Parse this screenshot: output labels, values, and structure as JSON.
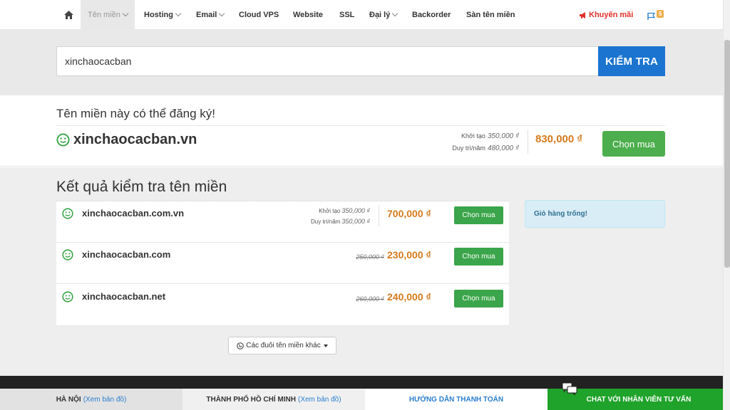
{
  "nav": {
    "items": [
      {
        "label": "Tên miền",
        "caret": true,
        "active": true
      },
      {
        "label": "Hosting",
        "caret": true
      },
      {
        "label": "Email",
        "caret": true
      },
      {
        "label": "Cloud VPS"
      },
      {
        "label": "Website"
      },
      {
        "label": "SSL"
      },
      {
        "label": "Đại lý",
        "caret": true
      },
      {
        "label": "Backorder"
      },
      {
        "label": "Sàn tên miền"
      }
    ],
    "promo": "Khuyến mãi",
    "flag_count": "5"
  },
  "search": {
    "value": "xinchaocacban",
    "button": "KIỂM TRA"
  },
  "available": {
    "heading": "Tên miền này có thể đăng ký!",
    "domain": "xinchaocacban.vn",
    "setup_label": "Khởi tạo",
    "setup_fee": "350,000 ₫",
    "renew_label": "Duy trì/năm",
    "renew_fee": "480,000 ₫",
    "price": "830,000 ₫",
    "buy_label": "Chọn mua"
  },
  "results": {
    "heading": "Kết quả kiểm tra tên miền",
    "rows": [
      {
        "domain": "xinchaocacban.com.vn",
        "setup_label": "Khởi tạo",
        "setup_fee": "350,000 ₫",
        "renew_label": "Duy trì/năm",
        "renew_fee": "350,000 ₫",
        "price": "700,000 ₫",
        "buy_label": "Chọn mua"
      },
      {
        "domain": "xinchaocacban.com",
        "old_price": "250,000 ₫",
        "price": "230,000 ₫",
        "buy_label": "Chọn mua"
      },
      {
        "domain": "xinchaocacban.net",
        "old_price": "260,000 ₫",
        "price": "240,000 ₫",
        "buy_label": "Chọn mua"
      }
    ],
    "more_label": "Các đuôi tên miền khác"
  },
  "cart": {
    "label": "Giỏ hàng trống!"
  },
  "footer": {
    "hanoi": "HÀ NỘI",
    "hanoi_link": "(Xem bản đồ)",
    "hcm": "THÀNH PHỐ HỒ CHÍ MINH",
    "hcm_link": "(Xem bản đồ)",
    "payment": "HƯỚNG DẪN THANH TOÁN",
    "chat": "CHAT VỚI NHÂN VIÊN TƯ VẤN"
  },
  "colors": {
    "primary": "#1a74d0",
    "buy": "#4cae4c",
    "price": "#d57a1c",
    "chat_bg": "#1fa32a",
    "available_icon": "#3aa54a"
  }
}
